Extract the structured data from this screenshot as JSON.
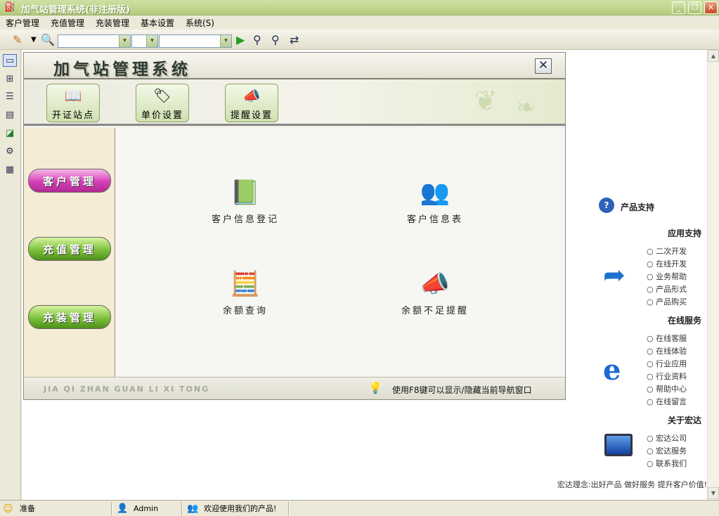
{
  "window": {
    "title": "加气站管理系统(非注册版)",
    "minimize": "_",
    "restore": "❐",
    "close": "✕"
  },
  "menu": [
    "客户管理",
    "充值管理",
    "充装管理",
    "基本设置",
    "系统(S)"
  ],
  "toolbar": {
    "combo1": "",
    "combo2": "",
    "combo3": "",
    "arrow": "▾",
    "icons": [
      "pencil-icon",
      "search-icon",
      "play-icon",
      "binoculars-icon",
      "binoculars-next-icon",
      "swap-icon"
    ]
  },
  "lefttool_icons": [
    "window-icon",
    "tree-icon",
    "list-icon",
    "document-icon",
    "chart-icon",
    "settings-icon",
    "report-icon"
  ],
  "nav": {
    "title": "加气站管理系统",
    "close": "✕",
    "quick": [
      {
        "label": "开证站点",
        "icon": "book-icon"
      },
      {
        "label": "单价设置",
        "icon": "price-icon"
      },
      {
        "label": "提醒设置",
        "icon": "megaphone-icon"
      }
    ],
    "side": [
      "客户管理",
      "充值管理",
      "充装管理"
    ],
    "items": [
      {
        "label": "客户信息登记",
        "icon": "notebook-icon"
      },
      {
        "label": "客户信息表",
        "icon": "users-book-icon"
      },
      {
        "label": "余额查询",
        "icon": "calculator-coins-icon"
      },
      {
        "label": "余额不足提醒",
        "icon": "megaphone-icon"
      }
    ],
    "footer_left": "JIA QI ZHAN GUAN LI XI TONG",
    "footer_right": "使用F8键可以显示/隐藏当前导航窗口"
  },
  "support": {
    "title": "产品支持",
    "sections": [
      {
        "title": "应用支持",
        "items": [
          "二次开发",
          "在线开发",
          "业务帮助",
          "产品形式",
          "产品购买"
        ]
      },
      {
        "title": "在线服务",
        "items": [
          "在线客服",
          "在线体验",
          "行业应用",
          "行业资料",
          "帮助中心",
          "在线留言"
        ]
      },
      {
        "title": "关于宏达",
        "items": [
          "宏达公司",
          "宏达服务",
          "联系我们"
        ]
      }
    ],
    "motto": "宏达理念:出好产品  做好服务  提升客户价值!"
  },
  "status": {
    "left": "准备",
    "user": "Admin",
    "message": "欢迎使用我们的产品!"
  },
  "colors": {
    "titlebar": "#b3cc7c",
    "pink_button": "#d63fb8",
    "green_button": "#7cc13a"
  }
}
